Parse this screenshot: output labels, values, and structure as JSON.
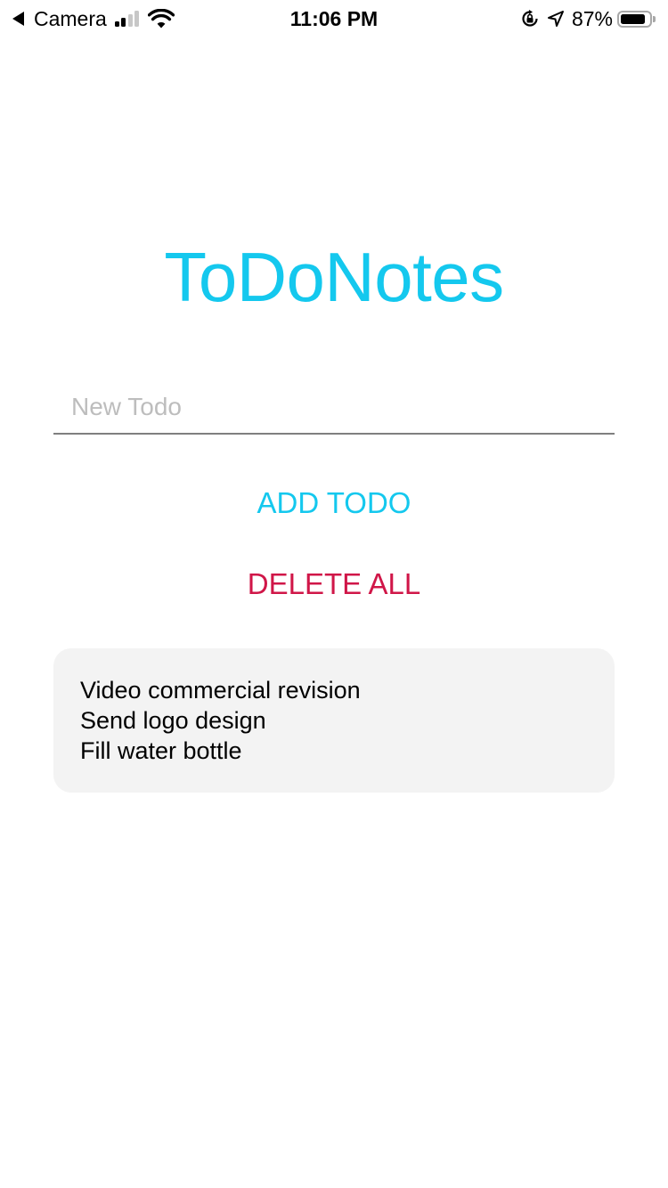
{
  "status_bar": {
    "back_label": "Camera",
    "time": "11:06 PM",
    "battery_percent_label": "87%",
    "battery_level": 0.87,
    "signal_bars_active": 2,
    "signal_bars_total": 4,
    "icons": [
      "back-arrow-icon",
      "cellular-signal-icon",
      "wifi-icon",
      "orientation-lock-icon",
      "location-arrow-icon",
      "battery-icon"
    ]
  },
  "app": {
    "title": "ToDoNotes",
    "input": {
      "value": "",
      "placeholder": "New Todo"
    },
    "add_button_label": "ADD TODO",
    "delete_all_button_label": "DELETE ALL",
    "todos": [
      "Video commercial revision",
      "Send logo design",
      "Fill water bottle"
    ]
  },
  "colors": {
    "accent": "#14c8ee",
    "danger": "#d01648",
    "card_background": "#f3f3f3",
    "placeholder": "#bdbdbd"
  }
}
